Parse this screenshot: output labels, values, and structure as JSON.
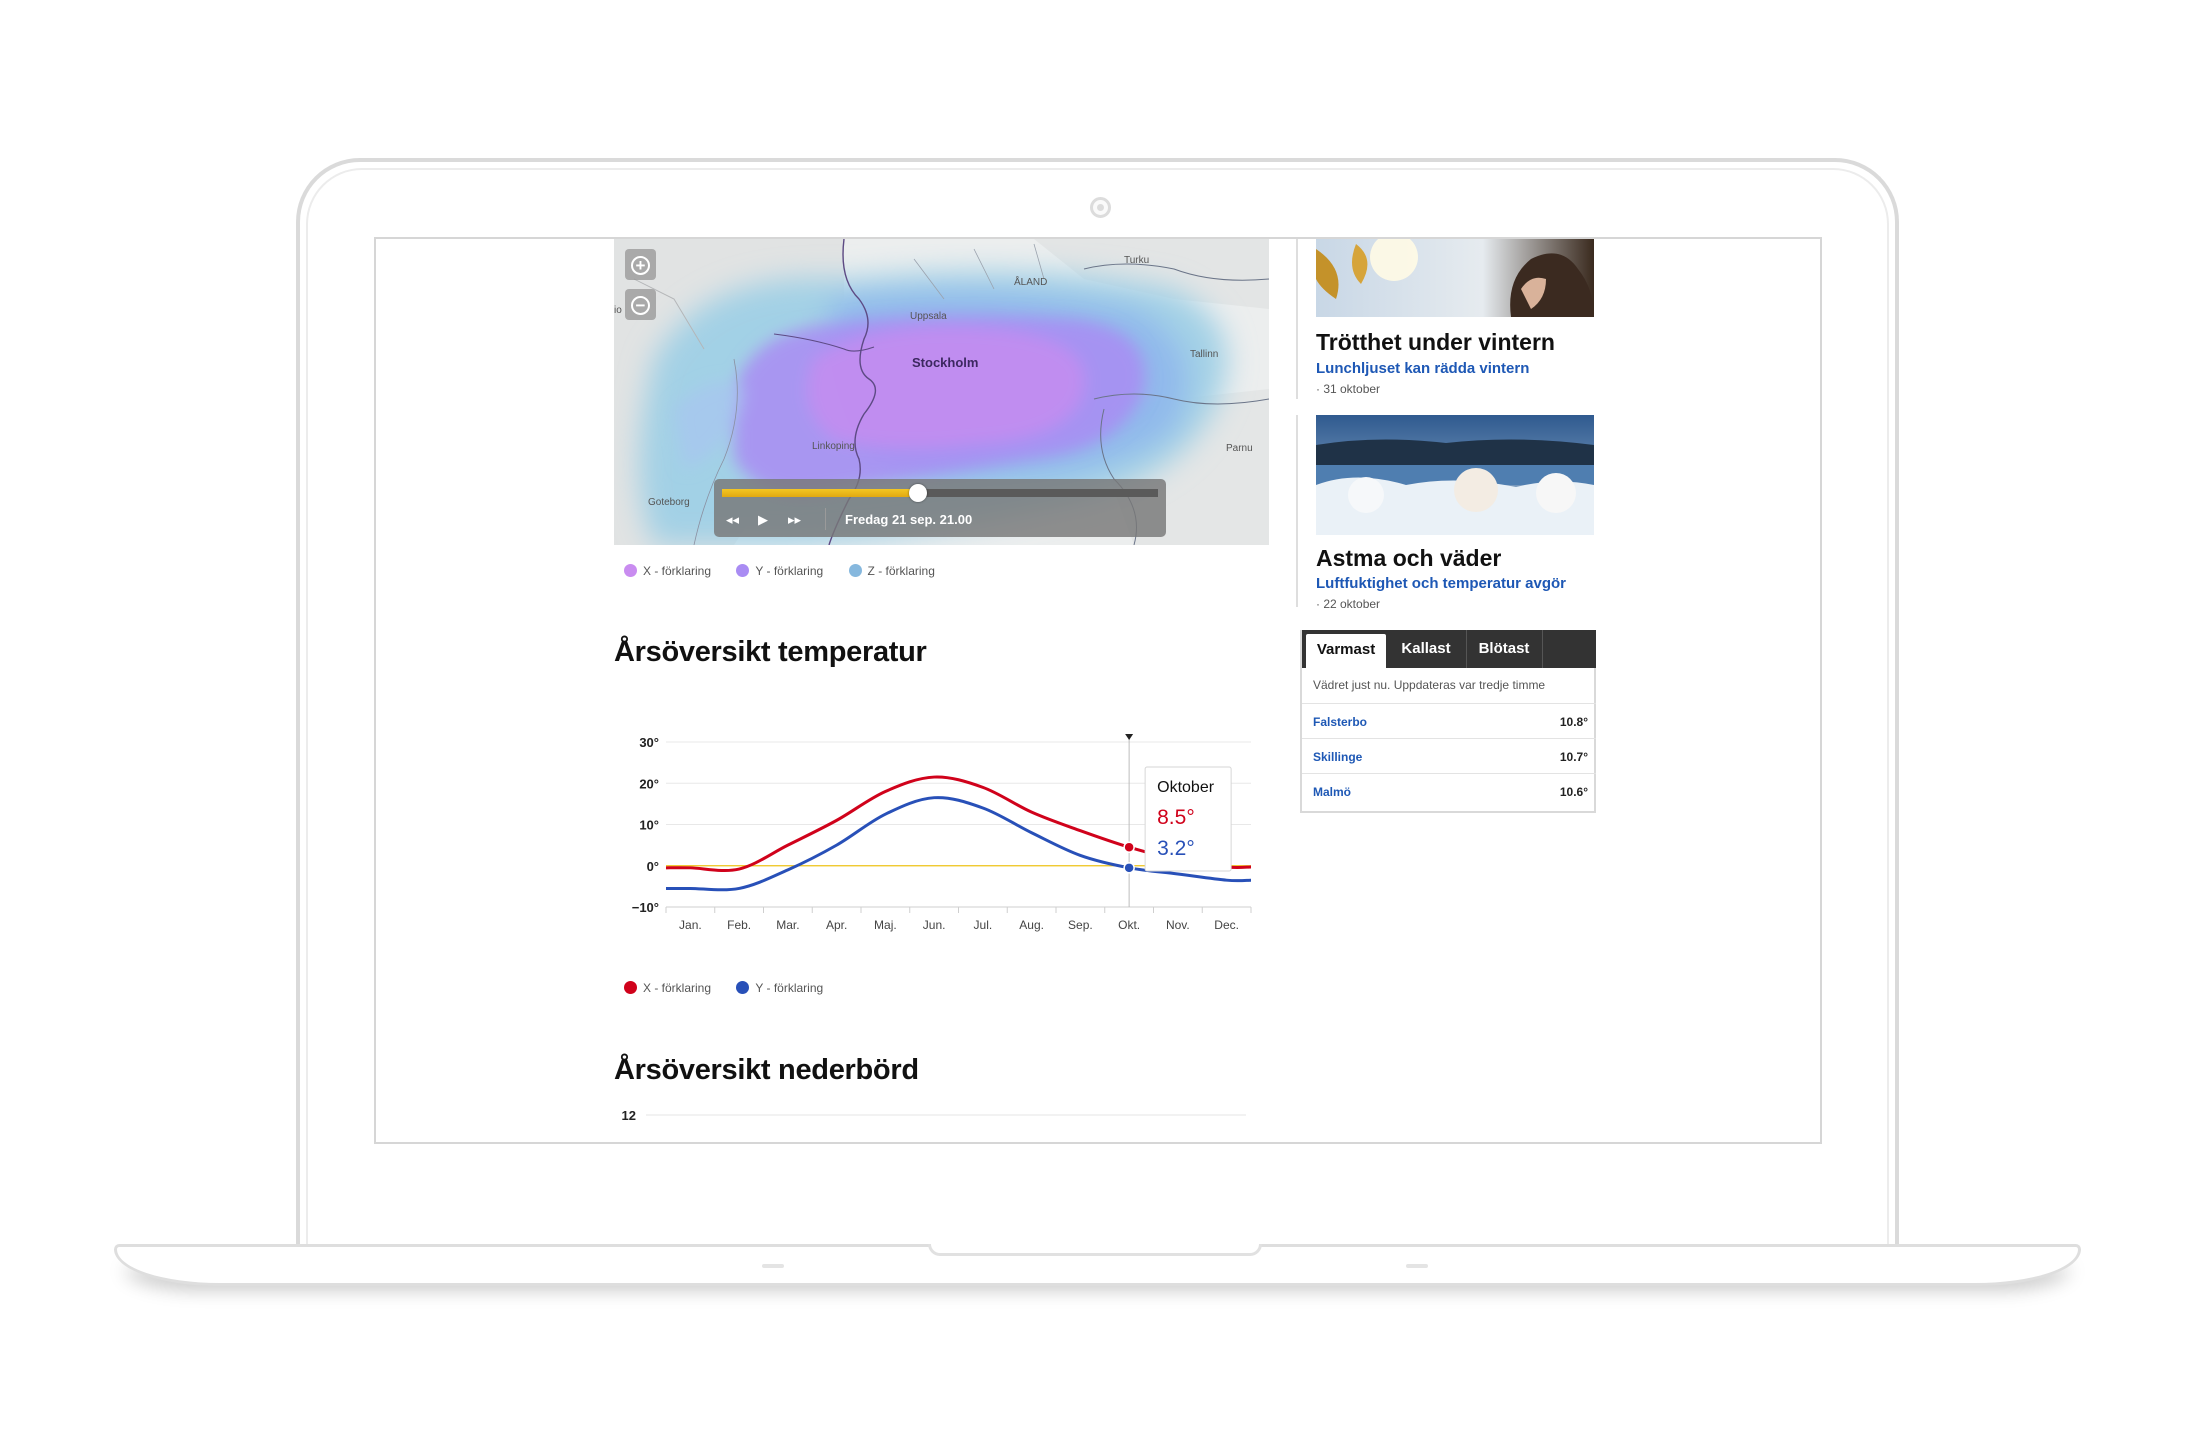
{
  "map": {
    "labels": {
      "turku": "Turku",
      "aland": "ÅLAND",
      "uppsala": "Uppsala",
      "stockholm": "Stockholm",
      "tallinn": "Tallinn",
      "linkoping": "Linkoping",
      "parnu": "Parnu",
      "goteborg": "Goteborg",
      "edge": "io"
    },
    "zoom_in": "+",
    "zoom_out": "−",
    "player": {
      "rewind": "◂◂",
      "play": "▶",
      "forward": "▸▸",
      "time": "Fredag 21 sep. 21.00",
      "progress": 0.45
    },
    "legend": [
      {
        "label": "X - förklaring",
        "color": "#c98cf0"
      },
      {
        "label": "Y - förklaring",
        "color": "#a98cf3"
      },
      {
        "label": "Z - förklaring",
        "color": "#86b8de"
      }
    ]
  },
  "temperature_section": {
    "title": "Årsöversikt temperatur",
    "tooltip": {
      "month": "Oktober",
      "x_value": "8.5°",
      "y_value": "3.2°"
    },
    "legend": [
      {
        "label": "X - förklaring",
        "color": "#d0021b"
      },
      {
        "label": "Y - förklaring",
        "color": "#2850b8"
      }
    ]
  },
  "precipitation_section": {
    "title": "Årsöversikt nederbörd",
    "first_tick": "12"
  },
  "chart_data": {
    "type": "line",
    "categories": [
      "Jan.",
      "Feb.",
      "Mar.",
      "Apr.",
      "Maj.",
      "Jun.",
      "Jul.",
      "Aug.",
      "Sep.",
      "Okt.",
      "Nov.",
      "Dec."
    ],
    "y_ticks": [
      "30°",
      "20°",
      "10°",
      "0°",
      "−10°"
    ],
    "ylim": [
      -10,
      30
    ],
    "highlight_category": "Okt.",
    "series": [
      {
        "name": "X - förklaring",
        "color": "#d0021b",
        "values": [
          -0.5,
          -0.8,
          5,
          11,
          18,
          21.5,
          19,
          13,
          8.5,
          4.5,
          1.5,
          -0.3
        ]
      },
      {
        "name": "Y - förklaring",
        "color": "#2850b8",
        "values": [
          -5.5,
          -5.5,
          -1,
          5,
          12.5,
          16.5,
          14,
          8,
          2.5,
          -0.5,
          -2,
          -3.5
        ]
      }
    ]
  },
  "articles": [
    {
      "title": "Trötthet under vintern",
      "subtitle": "Lunchljuset kan rädda vintern",
      "date": "· 31 oktober"
    },
    {
      "title": "Astma och väder",
      "subtitle": "Luftfuktighet och temperatur avgör",
      "date": "· 22 oktober"
    }
  ],
  "weather_widget": {
    "tabs": [
      "Varmast",
      "Kallast",
      "Blötast"
    ],
    "note": "Vädret just nu. Uppdateras var tredje timme",
    "rows": [
      {
        "place": "Falsterbo",
        "temp": "10.8°"
      },
      {
        "place": "Skillinge",
        "temp": "10.7°"
      },
      {
        "place": "Malmö",
        "temp": "10.6°"
      }
    ]
  }
}
